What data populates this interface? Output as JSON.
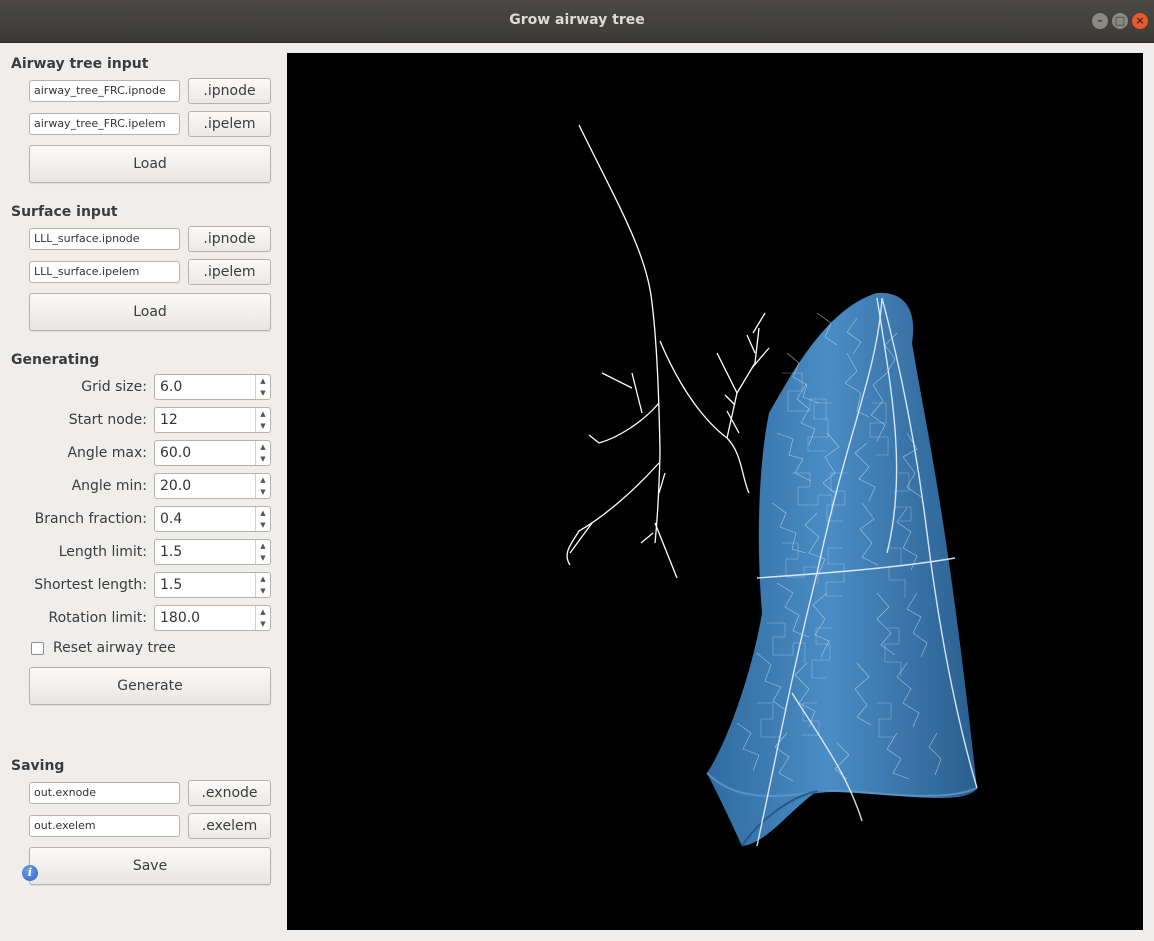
{
  "window": {
    "title": "Grow airway tree",
    "minimize_glyph": "–",
    "maximize_glyph": "□",
    "close_glyph": "×"
  },
  "airway_input": {
    "title": "Airway tree input",
    "node_file": "airway_tree_FRC.ipnode",
    "node_button": ".ipnode",
    "elem_file": "airway_tree_FRC.ipelem",
    "elem_button": ".ipelem",
    "load_label": "Load"
  },
  "surface_input": {
    "title": "Surface input",
    "node_file": "LLL_surface.ipnode",
    "node_button": ".ipnode",
    "elem_file": "LLL_surface.ipelem",
    "elem_button": ".ipelem",
    "load_label": "Load"
  },
  "generating": {
    "title": "Generating",
    "params": [
      {
        "label": "Grid size:",
        "value": "6.0"
      },
      {
        "label": "Start node:",
        "value": "12"
      },
      {
        "label": "Angle max:",
        "value": "60.0"
      },
      {
        "label": "Angle min:",
        "value": "20.0"
      },
      {
        "label": "Branch fraction:",
        "value": "0.4"
      },
      {
        "label": "Length limit:",
        "value": "1.5"
      },
      {
        "label": "Shortest length:",
        "value": "1.5"
      },
      {
        "label": "Rotation limit:",
        "value": "180.0"
      }
    ],
    "reset_label": "Reset airway tree",
    "reset_checked": false,
    "generate_label": "Generate"
  },
  "saving": {
    "title": "Saving",
    "node_file": "out.exnode",
    "node_button": ".exnode",
    "elem_file": "out.exelem",
    "elem_button": ".exelem",
    "save_label": "Save"
  },
  "icons": {
    "info": "i",
    "spin_up": "▲",
    "spin_down": "▼"
  },
  "colors": {
    "surface": "#3d7db4",
    "airway": "#ffffff",
    "viewport_bg": "#000000"
  }
}
